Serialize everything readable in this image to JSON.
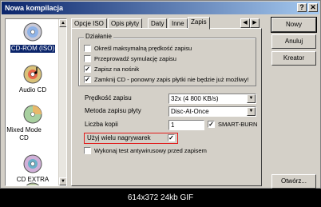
{
  "window": {
    "title": "Nowa kompilacja",
    "controls": [
      "?",
      "✕"
    ]
  },
  "sidebar": {
    "items": [
      {
        "label": "CD-ROM (ISO)",
        "selected": true,
        "icon": "cd-rom-icon"
      },
      {
        "label": "Audio CD",
        "selected": false,
        "icon": "audio-cd-icon"
      },
      {
        "label": "Mixed Mode CD",
        "selected": false,
        "icon": "mixed-mode-cd-icon"
      },
      {
        "label": "CD EXTRA",
        "selected": false,
        "icon": "cd-extra-icon"
      }
    ]
  },
  "tabs": [
    {
      "label": "Opcje ISO",
      "active": false
    },
    {
      "label": "Opis płyty",
      "active": false
    },
    {
      "label": "Daty",
      "active": false
    },
    {
      "label": "Inne",
      "active": false
    },
    {
      "label": "Zapis",
      "active": true
    }
  ],
  "action": {
    "group_title": "Działanie",
    "options": [
      {
        "label": "Określ maksymalną prędkość zapisu",
        "checked": false
      },
      {
        "label": "Przeprowadź symulację zapisu",
        "checked": false
      },
      {
        "label": "Zapisz na nośnik",
        "checked": true
      },
      {
        "label": "Zamknij CD - ponowny zapis płytki nie będzie już możliwy!",
        "checked": true
      }
    ]
  },
  "settings": {
    "speed_label": "Prędkość zapisu",
    "speed_value": "32x (4 800 KB/s)",
    "method_label": "Metoda zapisu płyty",
    "method_value": "Disc-At-Once",
    "copies_label": "Liczba kopii",
    "copies_value": "1",
    "smartburn_label": "SMART-BURN",
    "smartburn_checked": true,
    "multi_label": "Użyj wielu nagrywarek",
    "multi_checked": true,
    "antivirus_label": "Wykonaj test antywirusowy przed zapisem",
    "antivirus_checked": false
  },
  "buttons": {
    "new": "Nowy",
    "cancel": "Anuluj",
    "wizard": "Kreator",
    "open": "Otwórz..."
  },
  "caption": "614x372 24kb GIF",
  "colors": {
    "title_start": "#0a246a",
    "title_end": "#a6caf0",
    "highlight": "#e11a1a",
    "face": "#d4d0c8"
  }
}
